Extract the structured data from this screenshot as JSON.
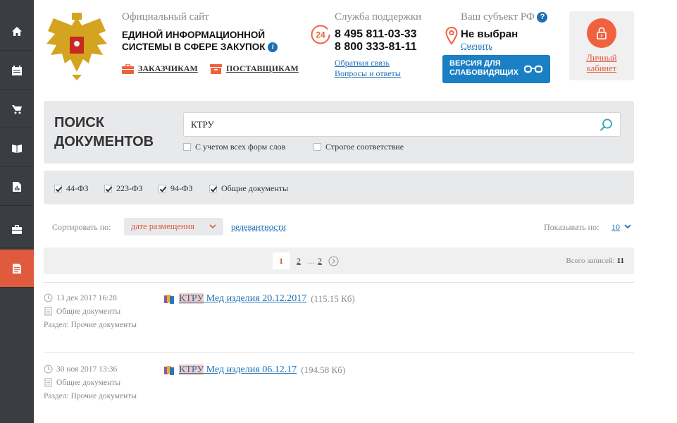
{
  "header": {
    "official_site": "Официальный сайт",
    "eis_line1": "ЕДИНОЙ ИНФОРМАЦИОННОЙ",
    "eis_line2": "СИСТЕМЫ В СФЕРЕ ЗАКУПОК",
    "customers_link": "ЗАКАЗЧИКАМ",
    "suppliers_link": "ПОСТАВЩИКАМ"
  },
  "support": {
    "title": "Служба поддержки",
    "badge": "24",
    "phone1": "8 495 811-03-33",
    "phone2": "8 800 333-81-11",
    "feedback_link": "Обратная связь",
    "faq_link": "Вопросы и ответы"
  },
  "region": {
    "title": "Ваш субъект РФ",
    "help_mark": "?",
    "value": "Не выбран",
    "change_link": "Сменить"
  },
  "accessibility_button": {
    "line1": "ВЕРСИЯ ДЛЯ",
    "line2": "СЛАБОВИДЯЩИХ"
  },
  "cabinet": {
    "line1": "Личный",
    "line2": "кабинет"
  },
  "search": {
    "heading_line1": "ПОИСК",
    "heading_line2": "ДОКУМЕНТОВ",
    "query": "КТРУ",
    "options": [
      {
        "label": "С учетом всех форм слов",
        "checked": false
      },
      {
        "label": "Строгое соответствие",
        "checked": false
      }
    ]
  },
  "filters": [
    {
      "label": "44-ФЗ",
      "checked": true
    },
    {
      "label": "223-ФЗ",
      "checked": true
    },
    {
      "label": "94-ФЗ",
      "checked": true
    },
    {
      "label": "Общие документы",
      "checked": true
    }
  ],
  "sort": {
    "label": "Сортировать по:",
    "selected": "дате размещения",
    "alternative": "релевантности",
    "show_label": "Показывать по:",
    "show_value": "10"
  },
  "pagination": {
    "current": "1",
    "pages": [
      "2",
      "2"
    ],
    "dots": "...",
    "total_label": "Всего записей:",
    "total_value": "11"
  },
  "results": [
    {
      "date": "13 дек 2017 16:28",
      "category": "Общие документы",
      "section": "Раздел: Прочие документы",
      "highlight": "КТРУ",
      "title": " Мед изделия 20.12.2017",
      "size": "(115.15 Кб)"
    },
    {
      "date": "30 ноя 2017 13:36",
      "category": "Общие документы",
      "section": "Раздел: Прочие документы",
      "highlight": "КТРУ",
      "title": " Мед изделия 06.12.17",
      "size": "(194.58 Кб)"
    }
  ],
  "colors": {
    "accent": "#e05a3e",
    "link": "#1b6fb5",
    "sidebar": "#3a3e42",
    "panel": "#e8e9eb"
  }
}
